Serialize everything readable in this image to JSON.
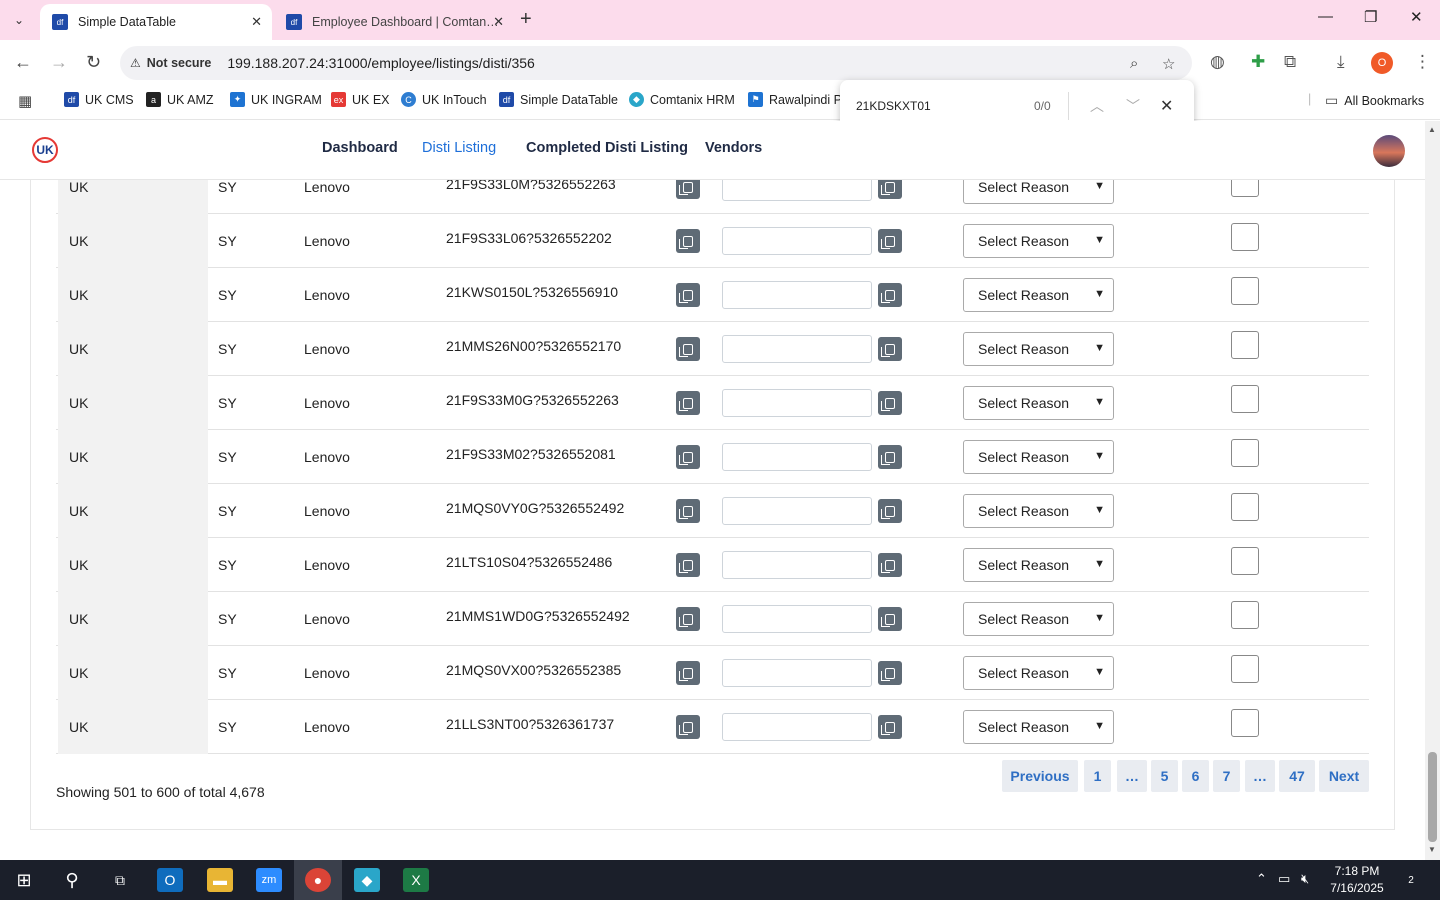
{
  "browser": {
    "tabs": [
      {
        "label": "Simple DataTable",
        "favicon": "df",
        "active": true
      },
      {
        "label": "Employee Dashboard | Comtan…",
        "favicon": "df",
        "active": false
      }
    ],
    "security_label": "Not secure",
    "url": "199.188.207.24:31000/employee/listings/disti/356",
    "profile_initial": "O",
    "bookmarks": [
      {
        "label": "UK CMS",
        "icon_color": "#1f4aa8",
        "icon": "df"
      },
      {
        "label": "UK AMZ",
        "icon_color": "#222222",
        "icon": "a"
      },
      {
        "label": "UK INGRAM",
        "icon_color": "#1e73d2",
        "icon": "✦"
      },
      {
        "label": "UK EX",
        "icon_color": "#e53935",
        "icon": "ex"
      },
      {
        "label": "UK InTouch",
        "icon_color": "#2e7dd1",
        "icon": "C"
      },
      {
        "label": "Simple DataTable",
        "icon_color": "#1f4aa8",
        "icon": "df"
      },
      {
        "label": "Comtanix HRM",
        "icon_color": "#2aa6c9",
        "icon": "◆"
      },
      {
        "label": "Rawalpindi Pr",
        "icon_color": "#1e73d2",
        "icon": "⚑"
      }
    ],
    "all_bookmarks_label": "All Bookmarks",
    "find": {
      "query": "21KDSKXT01",
      "count": "0/0"
    }
  },
  "app": {
    "nav": [
      {
        "label": "Dashboard",
        "active": false
      },
      {
        "label": "Disti Listing",
        "active": true
      },
      {
        "label": "Completed Disti Listing",
        "active": false
      },
      {
        "label": "Vendors",
        "active": false
      }
    ]
  },
  "table": {
    "select_placeholder": "Select Reason",
    "rows": [
      {
        "country": "UK",
        "code": "SY",
        "brand": "Lenovo",
        "serial": "21F9S33L0M?5326552263"
      },
      {
        "country": "UK",
        "code": "SY",
        "brand": "Lenovo",
        "serial": "21F9S33L06?5326552202"
      },
      {
        "country": "UK",
        "code": "SY",
        "brand": "Lenovo",
        "serial": "21KWS0150L?5326556910"
      },
      {
        "country": "UK",
        "code": "SY",
        "brand": "Lenovo",
        "serial": "21MMS26N00?5326552170"
      },
      {
        "country": "UK",
        "code": "SY",
        "brand": "Lenovo",
        "serial": "21F9S33M0G?5326552263"
      },
      {
        "country": "UK",
        "code": "SY",
        "brand": "Lenovo",
        "serial": "21F9S33M02?5326552081"
      },
      {
        "country": "UK",
        "code": "SY",
        "brand": "Lenovo",
        "serial": "21MQS0VY0G?5326552492"
      },
      {
        "country": "UK",
        "code": "SY",
        "brand": "Lenovo",
        "serial": "21LTS10S04?5326552486"
      },
      {
        "country": "UK",
        "code": "SY",
        "brand": "Lenovo",
        "serial": "21MMS1WD0G?5326552492"
      },
      {
        "country": "UK",
        "code": "SY",
        "brand": "Lenovo",
        "serial": "21MQS0VX00?5326552385"
      },
      {
        "country": "UK",
        "code": "SY",
        "brand": "Lenovo",
        "serial": "21LLS3NT00?5326361737"
      }
    ],
    "showing": "Showing 501 to 600 of total 4,678",
    "pagination": [
      "Previous",
      "1",
      "…",
      "5",
      "6",
      "7",
      "…",
      "47",
      "Next"
    ]
  },
  "taskbar": {
    "time": "7:18 PM",
    "date": "7/16/2025",
    "notifications": "2"
  }
}
